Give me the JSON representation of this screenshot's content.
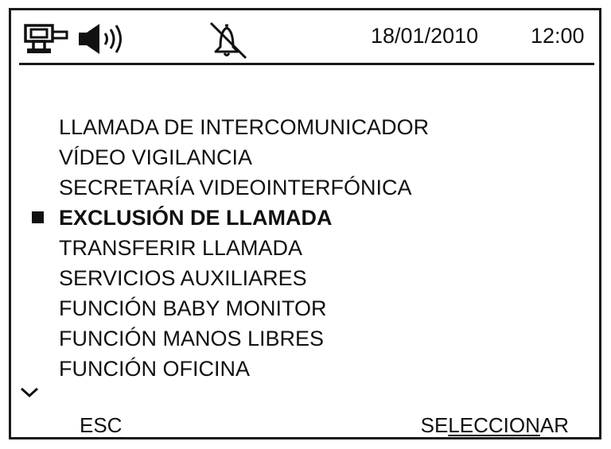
{
  "status_bar": {
    "icons": [
      "intercom-icon",
      "speaker-volume-icon",
      "bell-muted-icon"
    ],
    "date": "18/01/2010",
    "time": "12:00"
  },
  "menu": {
    "selected_index": 3,
    "items": [
      {
        "label": "LLAMADA DE INTERCOMUNICADOR"
      },
      {
        "label": "VÍDEO VIGILANCIA"
      },
      {
        "label": "SECRETARÍA VIDEOINTERFÓNICA"
      },
      {
        "label": "EXCLUSIÓN DE LLAMADA"
      },
      {
        "label": "TRANSFERIR LLAMADA"
      },
      {
        "label": "SERVICIOS AUXILIARES"
      },
      {
        "label": "FUNCIÓN BABY MONITOR"
      },
      {
        "label": "FUNCIÓN MANOS LIBRES"
      },
      {
        "label": "FUNCIÓN OFICINA"
      }
    ],
    "more_indicator": "chevron-down-icon"
  },
  "softkeys": {
    "esc_label": "ESC",
    "select_label_pre": "SE",
    "select_label_mid": "LECCION",
    "select_label_post": "AR"
  },
  "colors": {
    "foreground": "#111111",
    "background": "#ffffff"
  }
}
